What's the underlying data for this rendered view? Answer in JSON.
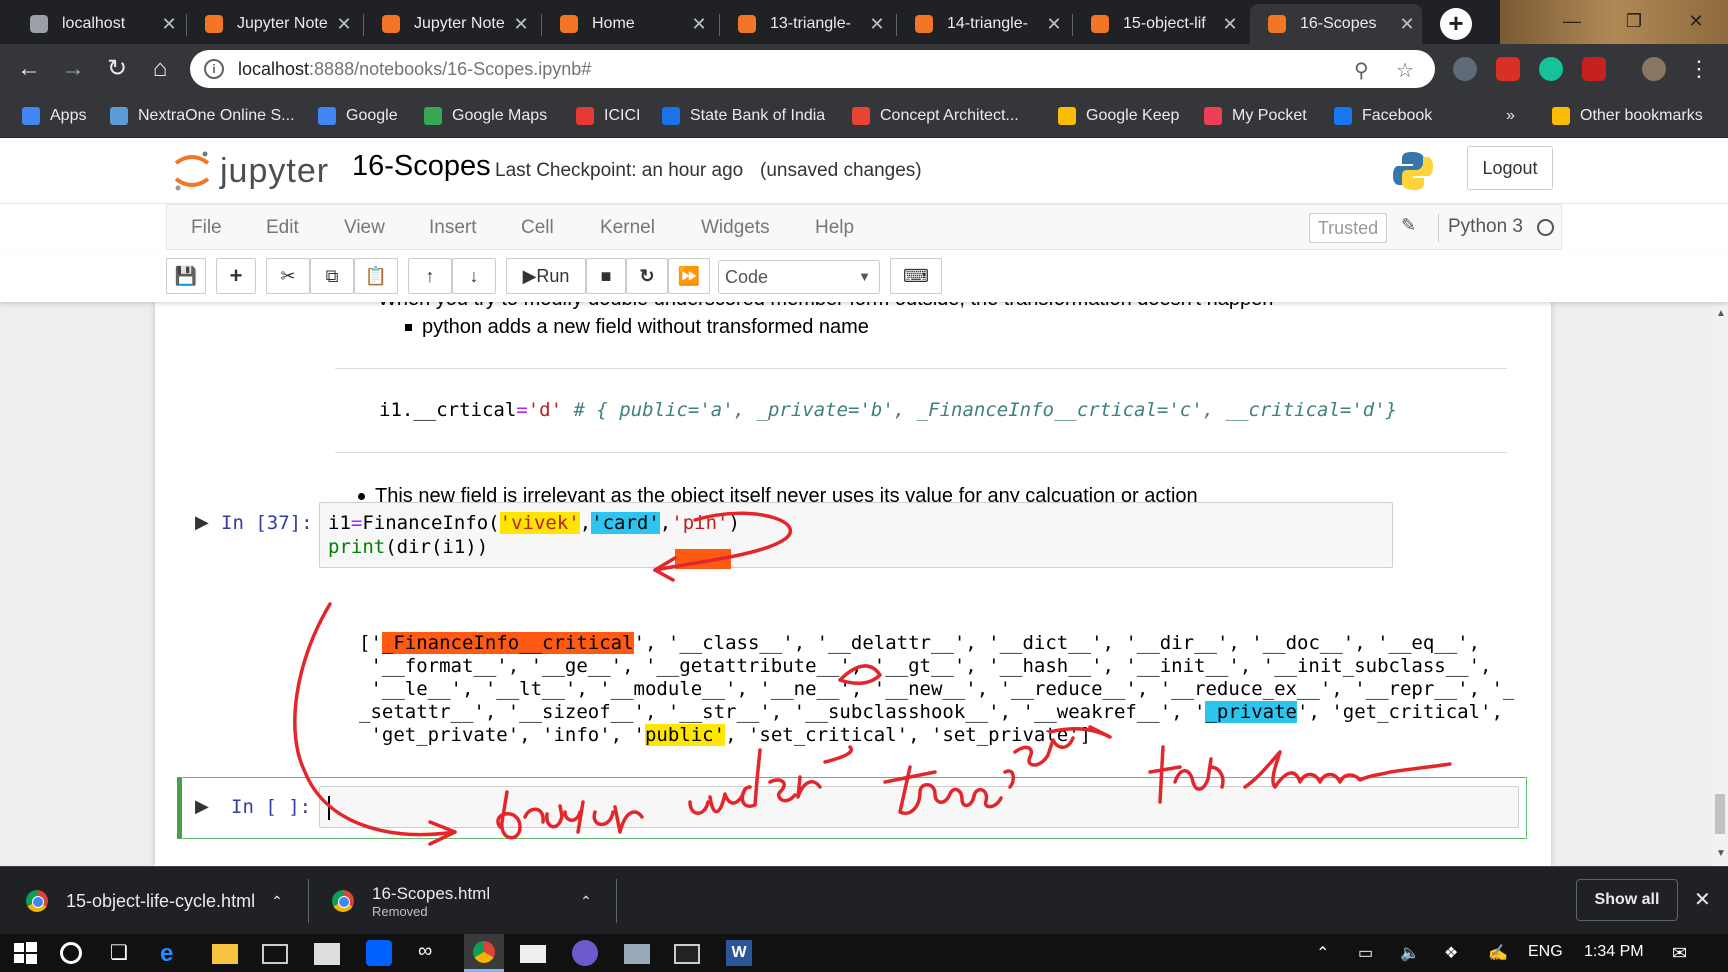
{
  "browser": {
    "tabs": [
      {
        "title": "localhost",
        "color": "#9aa0a6",
        "active": false
      },
      {
        "title": "Jupyter Note",
        "color": "#f37626",
        "active": false
      },
      {
        "title": "Jupyter Note",
        "color": "#f37626",
        "active": false
      },
      {
        "title": "Home",
        "color": "#f37626",
        "active": false
      },
      {
        "title": "13-triangle-",
        "color": "#f37626",
        "active": false
      },
      {
        "title": "14-triangle-",
        "color": "#f37626",
        "active": false
      },
      {
        "title": "15-object-lif",
        "color": "#f37626",
        "active": false
      },
      {
        "title": "16-Scopes",
        "color": "#f37626",
        "active": true
      }
    ],
    "new_tab": "+",
    "url_host": "localhost",
    "url_path": ":8888/notebooks/16-Scopes.ipynb#",
    "bookmarks": [
      {
        "label": "Apps",
        "color": "#4285f4"
      },
      {
        "label": "NextraOne Online S...",
        "color": "#5b9bd5"
      },
      {
        "label": "Google",
        "color": "#4285f4"
      },
      {
        "label": "Google Maps",
        "color": "#34a853"
      },
      {
        "label": "ICICI",
        "color": "#e53935"
      },
      {
        "label": "State Bank of India",
        "color": "#1a73e8"
      },
      {
        "label": "Concept Architect...",
        "color": "#ea4335"
      },
      {
        "label": "Google Keep",
        "color": "#fbbc04"
      },
      {
        "label": "My Pocket",
        "color": "#ef3f56"
      },
      {
        "label": "Facebook",
        "color": "#1877f2"
      }
    ],
    "bookmarks_overflow": "»",
    "other_bookmarks": "Other bookmarks"
  },
  "jupyter": {
    "logo": "jupyter",
    "notebook_name": "16-Scopes",
    "checkpoint": "Last Checkpoint: an hour ago",
    "unsaved": "(unsaved changes)",
    "logout": "Logout",
    "menu": [
      "File",
      "Edit",
      "View",
      "Insert",
      "Cell",
      "Kernel",
      "Widgets",
      "Help"
    ],
    "trusted": "Trusted",
    "kernel": "Python 3",
    "run_label": "Run",
    "cell_type": "Code"
  },
  "notebook": {
    "cut_line": "When you try to modify double underscored member form outside, the transformation doesn't happen",
    "bullet_sub": "python adds a new field without transformed name",
    "code_line": {
      "var": "i1.__crtical",
      "op": "=",
      "str": "'d'",
      "comment": "#  { public='a', _private='b', _FinanceInfo__crtical='c', __critical='d'}"
    },
    "bullet_main": "This new field is irrelevant as the object itself never uses its value for any calcuation or action",
    "cell1": {
      "prompt": "In [37]:",
      "line1": {
        "a": "i1",
        "op": "=",
        "b": "FinanceInfo(",
        "s1": "'vivek'",
        "c1": ",",
        "s2": "'card'",
        "c2": ",",
        "s3": "'pin'",
        "end": ")"
      },
      "line2": {
        "kw": "print",
        "rest": "(dir(i1))"
      },
      "output": {
        "l1a": "['",
        "l1hl": "_FinanceInfo__critical",
        "l1b": "', '__class__', '__delattr__', '__dict__', '__dir__', '__doc__', '__eq__',",
        "l2": " '__format__', '__ge__', '__getattribute__', '__gt__', '__hash__', '__init__', '__init_subclass__',",
        "l3": " '__le__', '__lt__', '__module__', '__ne__', '__new__', '__reduce__', '__reduce_ex__', '__repr__', '_",
        "l4a": "_setattr__', '__sizeof__', '__str__', '__subclasshook__', '__weakref__', '",
        "l4hl": "_private",
        "l4b": "', 'get_critical',",
        "l5a": " 'get_private', 'info', '",
        "l5hl": "public'",
        "l5b": ", 'set_critical', 'set_private']"
      }
    },
    "cell2": {
      "prompt": "In [ ]:"
    }
  },
  "annotation": {
    "handwriting": "double underscore transforms the name",
    "ink_color": "#e3262b"
  },
  "downloads": {
    "items": [
      {
        "name": "15-object-life-cycle.html",
        "status": ""
      },
      {
        "name": "16-Scopes.html",
        "status": "Removed"
      }
    ],
    "show_all": "Show all"
  },
  "taskbar": {
    "lang": "ENG",
    "time": "1:34 PM"
  }
}
